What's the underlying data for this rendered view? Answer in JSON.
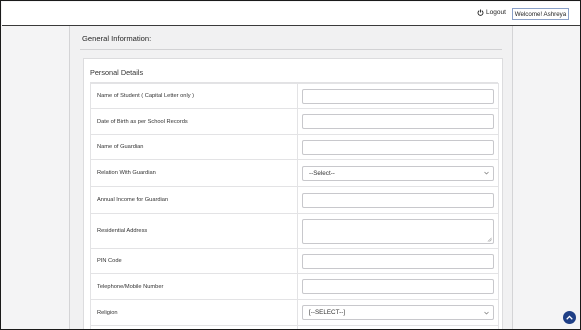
{
  "header": {
    "logout_label": "Logout",
    "welcome_text": "Welcome! Ashreya"
  },
  "main": {
    "section_title": "General Information:",
    "card_title": "Personal Details",
    "fields": {
      "student_name": {
        "label": "Name of Student ( Capital Letter only )",
        "value": ""
      },
      "dob": {
        "label": "Date of Birth as per School Records",
        "value": ""
      },
      "guardian_name": {
        "label": "Name of Guardian",
        "value": ""
      },
      "relation": {
        "label": "Relation With Guardian",
        "selected": "--Select--"
      },
      "annual_income": {
        "label": "Annual Income for Guardian",
        "value": ""
      },
      "address": {
        "label": "Residential Address",
        "value": ""
      },
      "pin_code": {
        "label": "PIN Code",
        "value": ""
      },
      "phone": {
        "label": "Telephone/Mobile Number",
        "value": ""
      },
      "religion": {
        "label": "Religion",
        "selected": "[--SELECT--]"
      }
    }
  },
  "colors": {
    "accent": "#1f3f86",
    "welcome_border": "#8aa0c8"
  },
  "icons": {
    "logout": "power-icon",
    "select_caret": "chevron-down-icon",
    "scroll_top": "chevron-up-icon"
  }
}
